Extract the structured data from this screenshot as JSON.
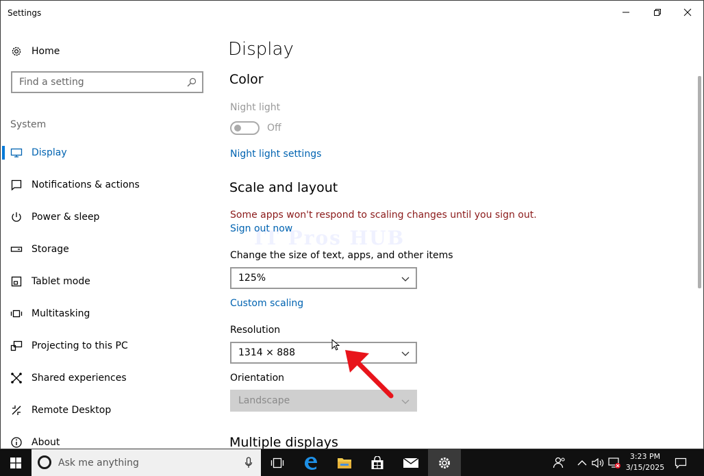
{
  "window": {
    "title": "Settings"
  },
  "sidebar": {
    "home_label": "Home",
    "search_placeholder": "Find a setting",
    "section_label": "System",
    "items": [
      {
        "label": "Display",
        "icon": "monitor-icon",
        "active": true
      },
      {
        "label": "Notifications & actions",
        "icon": "notifications-icon"
      },
      {
        "label": "Power & sleep",
        "icon": "power-icon"
      },
      {
        "label": "Storage",
        "icon": "storage-icon"
      },
      {
        "label": "Tablet mode",
        "icon": "tablet-icon"
      },
      {
        "label": "Multitasking",
        "icon": "multitasking-icon"
      },
      {
        "label": "Projecting to this PC",
        "icon": "projecting-icon"
      },
      {
        "label": "Shared experiences",
        "icon": "shared-icon"
      },
      {
        "label": "Remote Desktop",
        "icon": "remote-desktop-icon"
      },
      {
        "label": "About",
        "icon": "info-icon"
      }
    ]
  },
  "content": {
    "page_title": "Display",
    "color_heading": "Color",
    "night_light_label": "Night light",
    "night_light_state": "Off",
    "night_light_settings_link": "Night light settings",
    "scale_heading": "Scale and layout",
    "scale_warning": "Some apps won't respond to scaling changes until you sign out.",
    "sign_out_link": "Sign out now",
    "text_size_label": "Change the size of text, apps, and other items",
    "text_size_value": "125%",
    "custom_scaling_link": "Custom scaling",
    "resolution_label": "Resolution",
    "resolution_value": "1314 × 888",
    "orientation_label": "Orientation",
    "orientation_value": "Landscape",
    "multiple_displays_heading": "Multiple displays",
    "watermark": "IT Pros HUB"
  },
  "taskbar": {
    "search_placeholder": "Ask me anything",
    "time": "3:23 PM",
    "date": "3/15/2025"
  },
  "colors": {
    "accent": "#0078d7",
    "link": "#0063b1",
    "warning": "#8b1a1a",
    "annotation_arrow": "#e8141b"
  }
}
